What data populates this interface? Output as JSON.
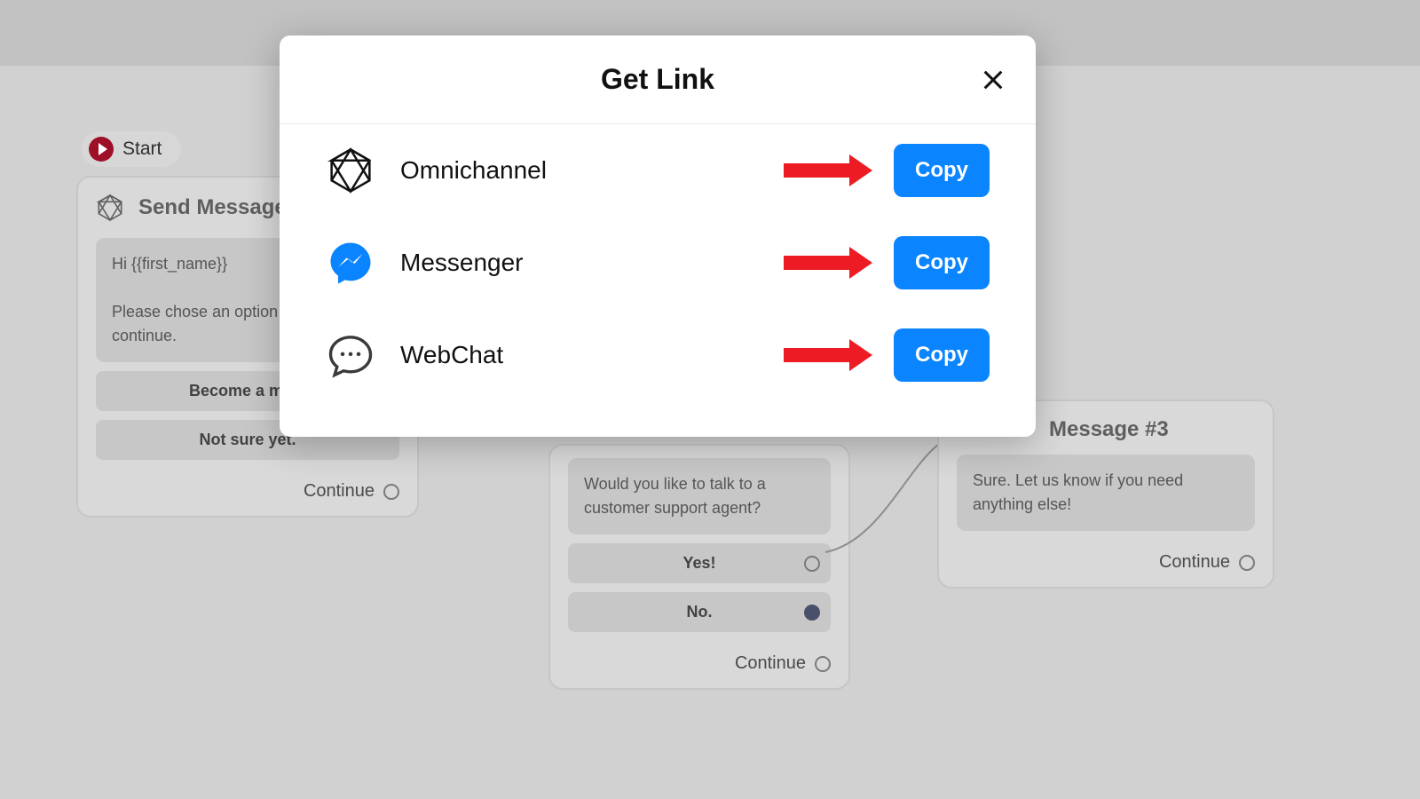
{
  "start": {
    "label": "Start"
  },
  "card1": {
    "title": "Send Message #",
    "message": "Hi {{first_name}}\n\nPlease chose an option be\ncontinue.",
    "options": [
      "Become a mem",
      "Not sure yet."
    ],
    "continue": "Continue"
  },
  "card2": {
    "message": "Would you like to talk to a customer support agent?",
    "options": [
      "Yes!",
      "No."
    ],
    "continue": "Continue"
  },
  "card3": {
    "title": "Message #3",
    "message": "Sure. Let us know if you need anything else!",
    "continue": "Continue"
  },
  "modal": {
    "title": "Get Link",
    "rows": [
      {
        "label": "Omnichannel",
        "button": "Copy"
      },
      {
        "label": "Messenger",
        "button": "Copy"
      },
      {
        "label": "WebChat",
        "button": "Copy"
      }
    ]
  }
}
